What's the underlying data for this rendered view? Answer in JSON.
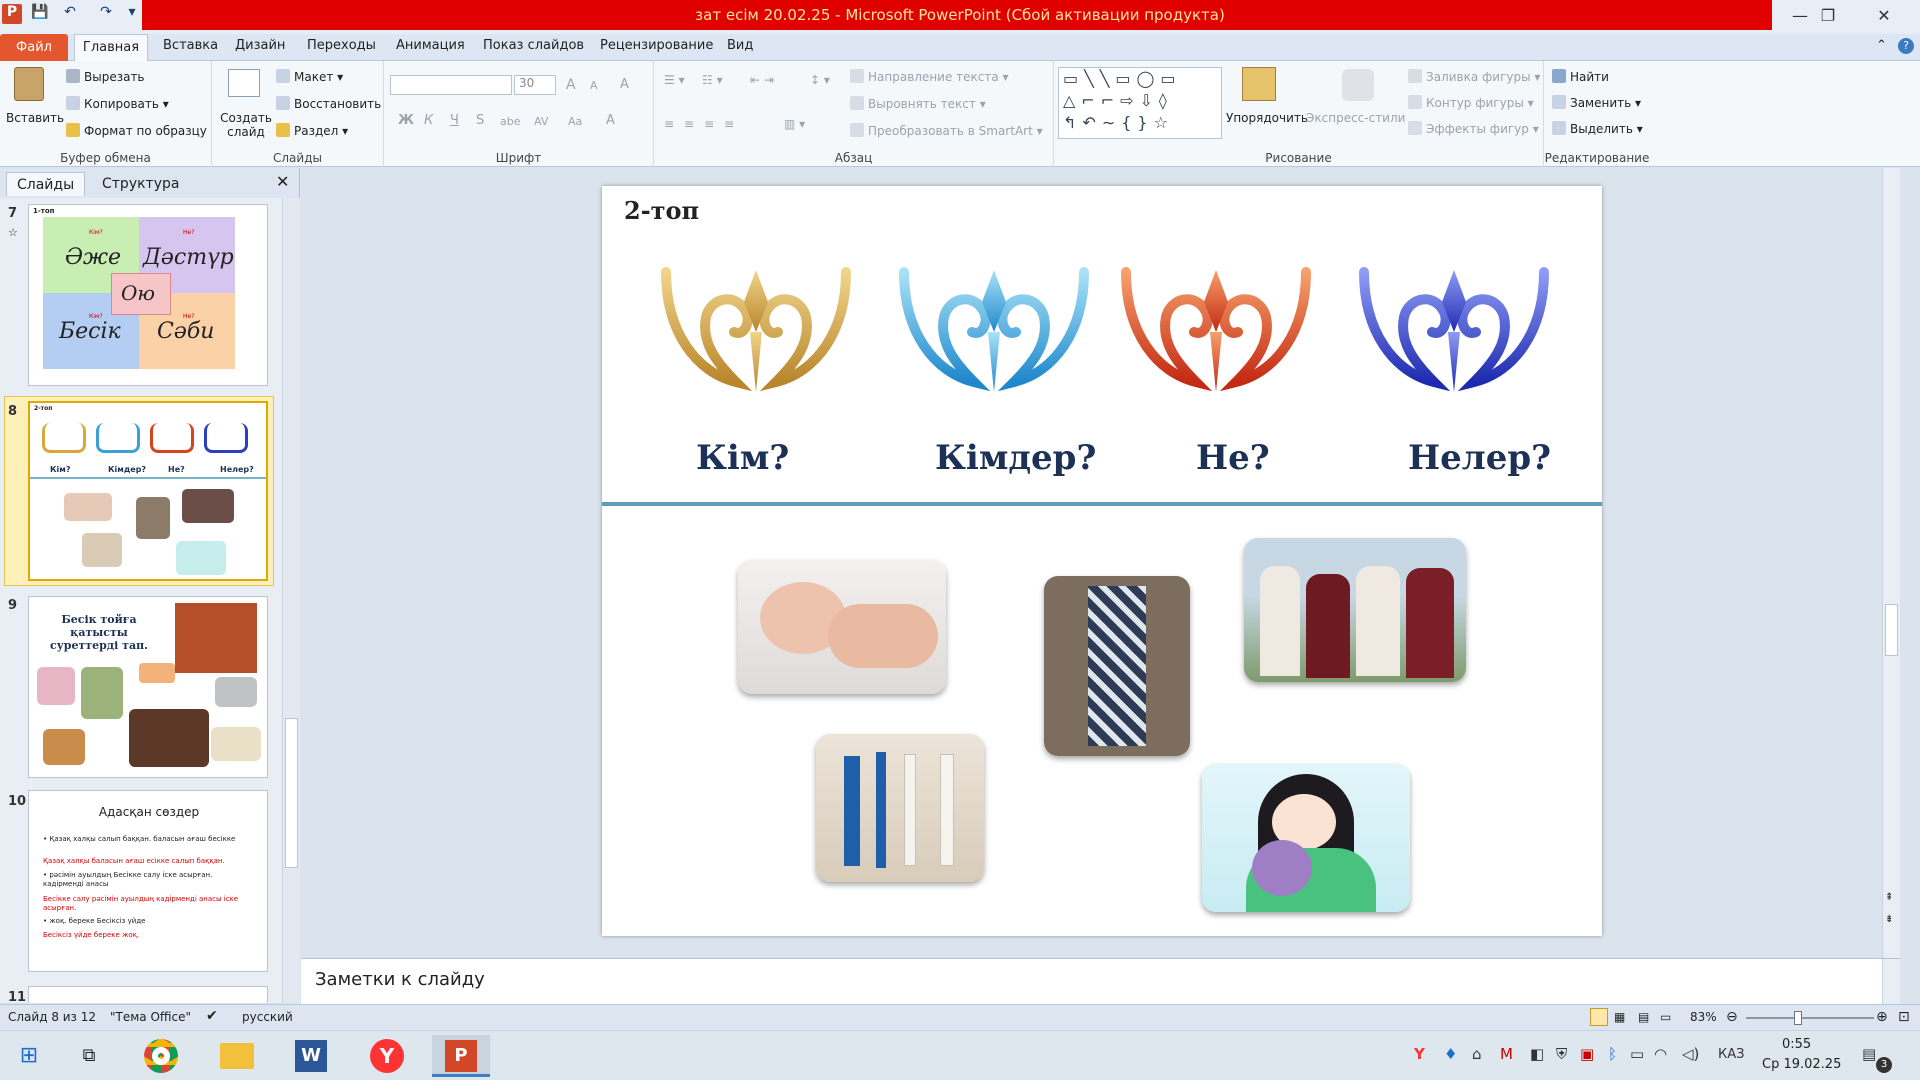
{
  "window": {
    "title": "зат есім 20.02.25  -  Microsoft PowerPoint (Сбой активации продукта)",
    "min": "—",
    "max": "❐",
    "close": "✕",
    "help": "?",
    "collapse": "⌃"
  },
  "quickaccess": {
    "app": "P",
    "save": "💾",
    "undo": "↶",
    "redo": "↷",
    "more": "▾"
  },
  "tabs": {
    "file": "Файл",
    "items": [
      "Главная",
      "Вставка",
      "Дизайн",
      "Переходы",
      "Анимация",
      "Показ слайдов",
      "Рецензирование",
      "Вид"
    ]
  },
  "ribbon": {
    "clipboard": {
      "label": "Буфер обмена",
      "paste": "Вставить",
      "cut": "Вырезать",
      "copy": "Копировать",
      "format": "Формат по образцу"
    },
    "slides": {
      "label": "Слайды",
      "new": "Создать слайд",
      "layout": "Макет",
      "reset": "Восстановить",
      "section": "Раздел"
    },
    "font": {
      "label": "Шрифт",
      "font_value": "",
      "size_value": "30",
      "bold": "Ж",
      "italic": "К",
      "underline": "Ч",
      "strike": "S",
      "abc": "abe",
      "spacing": "AV",
      "case": "Aa",
      "color": "A",
      "grow": "A",
      "shrink": "A",
      "clear": "A"
    },
    "paragraph": {
      "label": "Абзац",
      "text_dir": "Направление текста",
      "align_text": "Выровнять текст",
      "smartart": "Преобразовать в SmartArt"
    },
    "drawing": {
      "label": "Рисование",
      "arrange": "Упорядочить",
      "quick_styles": "Экспресс-стили",
      "fill": "Заливка фигуры",
      "outline": "Контур фигуры",
      "effects": "Эффекты фигур"
    },
    "editing": {
      "label": "Редактирование",
      "find": "Найти",
      "replace": "Заменить",
      "select": "Выделить"
    }
  },
  "panel": {
    "tab_slides": "Слайды",
    "tab_outline": "Структура",
    "close": "✕"
  },
  "thumbs": {
    "t7": {
      "num": "7",
      "title": "1-топ",
      "w1": "Әже",
      "w2": "Дәстүр",
      "w3": "Ою",
      "w4": "Бесік",
      "w5": "Сәби",
      "q1": "Кім?",
      "q2": "Не?",
      "q3": "Не?",
      "q4": "Кім?"
    },
    "t8": {
      "num": "8",
      "title": "2-топ",
      "q": [
        "Кім?",
        "Кімдер?",
        "Не?",
        "Нелер?"
      ]
    },
    "t9": {
      "num": "9",
      "title": "Бесік тойға қатысты суреттерді тап."
    },
    "t10": {
      "num": "10",
      "title": "Адасқан сөздер",
      "lines": [
        "• Қазақ халқы салып баққан. баласын ағаш бесікке",
        "Қазақ халқы баласын ағаш есікке салып баққан.",
        "• рәсімін ауылдың Бесікке салу іске асырған. кадірменді анасы",
        "Бесікке салу рәсімін ауылдың кадірменді анасы іске асырған.",
        "• жоқ. береке Бесіксіз үйде",
        "Бесіксіз үйде береке жоқ."
      ]
    },
    "t11": {
      "num": "11"
    }
  },
  "slide": {
    "title": "2-топ",
    "questions": [
      "Кім?",
      "Кімдер?",
      "Не?",
      "Нелер?"
    ]
  },
  "notes": {
    "placeholder": "Заметки к слайду"
  },
  "status": {
    "slide": "Слайд 8 из 12",
    "theme": "\"Тема Office\"",
    "lang": "русский",
    "zoom": "83%",
    "zoom_level": 0.83
  },
  "taskbar": {
    "lang": "КАЗ",
    "time": "0:55",
    "date": "Ср 19.02.25",
    "notif": "3"
  },
  "colors": {
    "accent_red": "#e10000",
    "file_tab": "#e4572e",
    "navy_text": "#1d3157"
  }
}
